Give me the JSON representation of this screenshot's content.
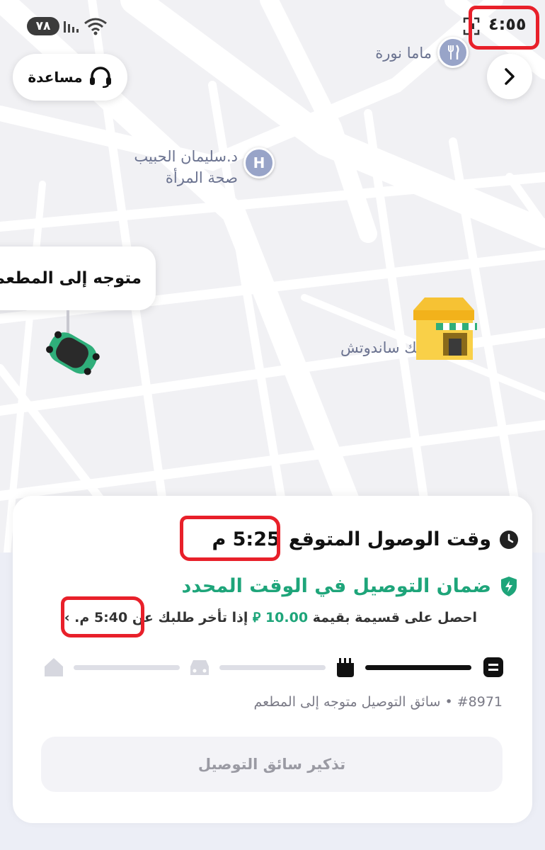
{
  "status_bar": {
    "battery": "٧٨",
    "time": "٤:٥٥"
  },
  "map": {
    "help_label": "مساعدة",
    "poi_restaurant": "ماما نورة",
    "poi_hospital_line1": "د.سليمان الحبيب",
    "poi_hospital_line2": "صحة المرأة",
    "hospital_pin_letter": "H",
    "driver_status_bubble": "متوجه إلى المطعم",
    "shop_label": "دانك ساندوتش"
  },
  "sheet": {
    "eta_label": "وقت الوصول المتوقع",
    "eta_time": "5:25 م",
    "guarantee_label": "ضمان التوصيل في الوقت المحدد",
    "credit_prefix": "احصل على قسيمة بقيمة",
    "credit_amount": "10.00",
    "currency_symbol": "⃁",
    "credit_middle": "إذا تأخر طلبك عن",
    "credit_time": "5:40 م.",
    "credit_chevron": "›",
    "order_number": "#8971",
    "order_status": "سائق التوصيل متوجه إلى المطعم",
    "remind_button": "تذكير سائق التوصيل"
  },
  "colors": {
    "accent_green": "#1ea57a",
    "annotation_red": "#e8202a",
    "pin_blue": "#98a4c8"
  },
  "progress_steps": [
    "order-icon",
    "restaurant-icon",
    "car-icon",
    "home-icon"
  ],
  "progress_active_step": 2
}
